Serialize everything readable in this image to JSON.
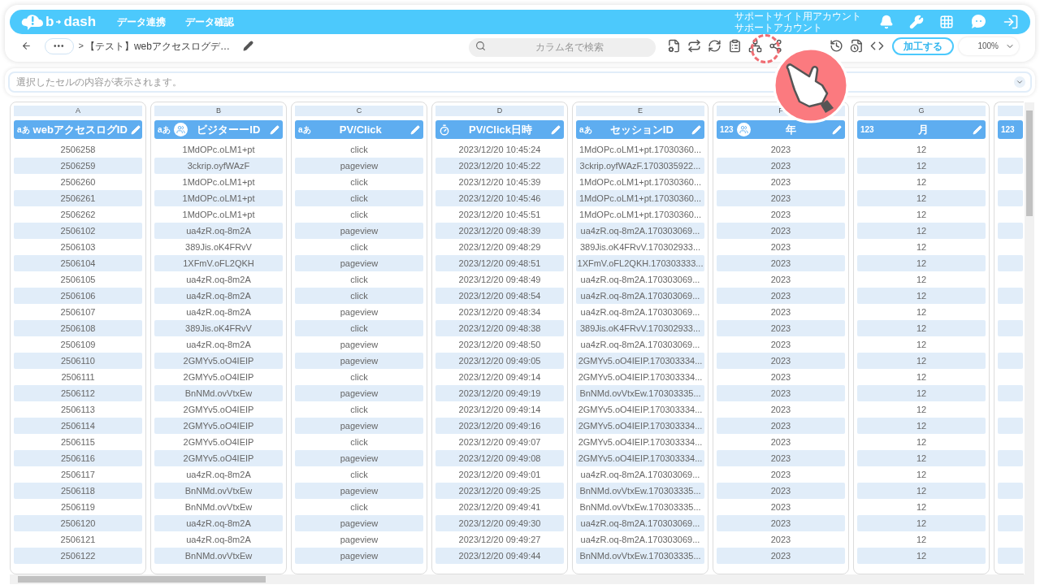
{
  "header": {
    "logo_left": "b",
    "logo_right": "dash",
    "nav": [
      "データ連携",
      "データ確認"
    ],
    "account": [
      "サポートサイト用アカウント",
      "サポートアカウント"
    ]
  },
  "toolbar": {
    "breadcrumb_more": "•••",
    "separator": ">",
    "title": "【テスト】webアクセスログデ…",
    "search": {
      "placeholder": "カラム名で検索"
    },
    "process_button": "加工する",
    "zoom": "100%"
  },
  "cell_display": {
    "placeholder": "選択したセルの内容が表示されます。"
  },
  "table": {
    "columns": [
      {
        "letter": "A",
        "name": "webアクセスログID",
        "kind": "text",
        "badge": "aあ",
        "grouped": false
      },
      {
        "letter": "B",
        "name": "ビジターーID",
        "kind": "text",
        "badge": "aあ",
        "grouped": true
      },
      {
        "letter": "C",
        "name": "PV/Click",
        "kind": "text",
        "badge": "aあ",
        "grouped": false
      },
      {
        "letter": "D",
        "name": "PV/Click日時",
        "kind": "datetime",
        "grouped": false
      },
      {
        "letter": "E",
        "name": "セッションID",
        "kind": "text",
        "badge": "aあ",
        "grouped": false
      },
      {
        "letter": "F",
        "name": "年",
        "kind": "number",
        "badge": "123",
        "grouped": true
      },
      {
        "letter": "G",
        "name": "月",
        "kind": "number",
        "badge": "123",
        "grouped": false
      },
      {
        "kind": "number",
        "badge": "123",
        "grouped": false,
        "partial": true
      }
    ],
    "rows": [
      [
        "2506258",
        "1MdOPc.oLM1+pt",
        "click",
        "2023/12/20 10:45:24",
        "1MdOPc.oLM1+pt.17030360...",
        "2023",
        "12"
      ],
      [
        "2506259",
        "3ckrip.oyfWAzF",
        "pageview",
        "2023/12/20 10:45:22",
        "3ckrip.oyfWAzF.1703035922...",
        "2023",
        "12"
      ],
      [
        "2506260",
        "1MdOPc.oLM1+pt",
        "click",
        "2023/12/20 10:45:39",
        "1MdOPc.oLM1+pt.17030360...",
        "2023",
        "12"
      ],
      [
        "2506261",
        "1MdOPc.oLM1+pt",
        "click",
        "2023/12/20 10:45:46",
        "1MdOPc.oLM1+pt.17030360...",
        "2023",
        "12"
      ],
      [
        "2506262",
        "1MdOPc.oLM1+pt",
        "click",
        "2023/12/20 10:45:51",
        "1MdOPc.oLM1+pt.17030360...",
        "2023",
        "12"
      ],
      [
        "2506102",
        "ua4zR.oq-8m2A",
        "pageview",
        "2023/12/20 09:48:39",
        "ua4zR.oq-8m2A.170303069...",
        "2023",
        "12"
      ],
      [
        "2506103",
        "389Jis.oK4FRvV",
        "click",
        "2023/12/20 09:48:29",
        "389Jis.oK4FRvV.170302933...",
        "2023",
        "12"
      ],
      [
        "2506104",
        "1XFmV.oFL2QKH",
        "pageview",
        "2023/12/20 09:48:51",
        "1XFmV.oFL2QKH.170303333...",
        "2023",
        "12"
      ],
      [
        "2506105",
        "ua4zR.oq-8m2A",
        "click",
        "2023/12/20 09:48:49",
        "ua4zR.oq-8m2A.170303069...",
        "2023",
        "12"
      ],
      [
        "2506106",
        "ua4zR.oq-8m2A",
        "click",
        "2023/12/20 09:48:54",
        "ua4zR.oq-8m2A.170303069...",
        "2023",
        "12"
      ],
      [
        "2506107",
        "ua4zR.oq-8m2A",
        "pageview",
        "2023/12/20 09:48:34",
        "ua4zR.oq-8m2A.170303069...",
        "2023",
        "12"
      ],
      [
        "2506108",
        "389Jis.oK4FRvV",
        "click",
        "2023/12/20 09:48:38",
        "389Jis.oK4FRvV.170302933...",
        "2023",
        "12"
      ],
      [
        "2506109",
        "ua4zR.oq-8m2A",
        "pageview",
        "2023/12/20 09:48:50",
        "ua4zR.oq-8m2A.170303069...",
        "2023",
        "12"
      ],
      [
        "2506110",
        "2GMYv5.oO4IEIP",
        "pageview",
        "2023/12/20 09:49:05",
        "2GMYv5.oO4IEIP.170303334...",
        "2023",
        "12"
      ],
      [
        "2506111",
        "2GMYv5.oO4IEIP",
        "click",
        "2023/12/20 09:49:14",
        "2GMYv5.oO4IEIP.170303334...",
        "2023",
        "12"
      ],
      [
        "2506112",
        "BnNMd.ovVtxEw",
        "pageview",
        "2023/12/20 09:49:19",
        "BnNMd.ovVtxEw.170303335...",
        "2023",
        "12"
      ],
      [
        "2506113",
        "2GMYv5.oO4IEIP",
        "click",
        "2023/12/20 09:49:14",
        "2GMYv5.oO4IEIP.170303334...",
        "2023",
        "12"
      ],
      [
        "2506114",
        "2GMYv5.oO4IEIP",
        "pageview",
        "2023/12/20 09:49:16",
        "2GMYv5.oO4IEIP.170303334...",
        "2023",
        "12"
      ],
      [
        "2506115",
        "2GMYv5.oO4IEIP",
        "click",
        "2023/12/20 09:49:07",
        "2GMYv5.oO4IEIP.170303334...",
        "2023",
        "12"
      ],
      [
        "2506116",
        "2GMYv5.oO4IEIP",
        "pageview",
        "2023/12/20 09:49:08",
        "2GMYv5.oO4IEIP.170303334...",
        "2023",
        "12"
      ],
      [
        "2506117",
        "ua4zR.oq-8m2A",
        "click",
        "2023/12/20 09:49:01",
        "ua4zR.oq-8m2A.170303069...",
        "2023",
        "12"
      ],
      [
        "2506118",
        "BnNMd.ovVtxEw",
        "pageview",
        "2023/12/20 09:49:25",
        "BnNMd.ovVtxEw.170303335...",
        "2023",
        "12"
      ],
      [
        "2506119",
        "BnNMd.ovVtxEw",
        "click",
        "2023/12/20 09:49:41",
        "BnNMd.ovVtxEw.170303335...",
        "2023",
        "12"
      ],
      [
        "2506120",
        "ua4zR.oq-8m2A",
        "pageview",
        "2023/12/20 09:49:30",
        "ua4zR.oq-8m2A.170303069...",
        "2023",
        "12"
      ],
      [
        "2506121",
        "ua4zR.oq-8m2A",
        "pageview",
        "2023/12/20 09:49:27",
        "ua4zR.oq-8m2A.170303069...",
        "2023",
        "12"
      ],
      [
        "2506122",
        "BnNMd.ovVtxEw",
        "pageview",
        "2023/12/20 09:49:44",
        "BnNMd.ovVtxEw.170303335...",
        "2023",
        "12"
      ]
    ]
  }
}
